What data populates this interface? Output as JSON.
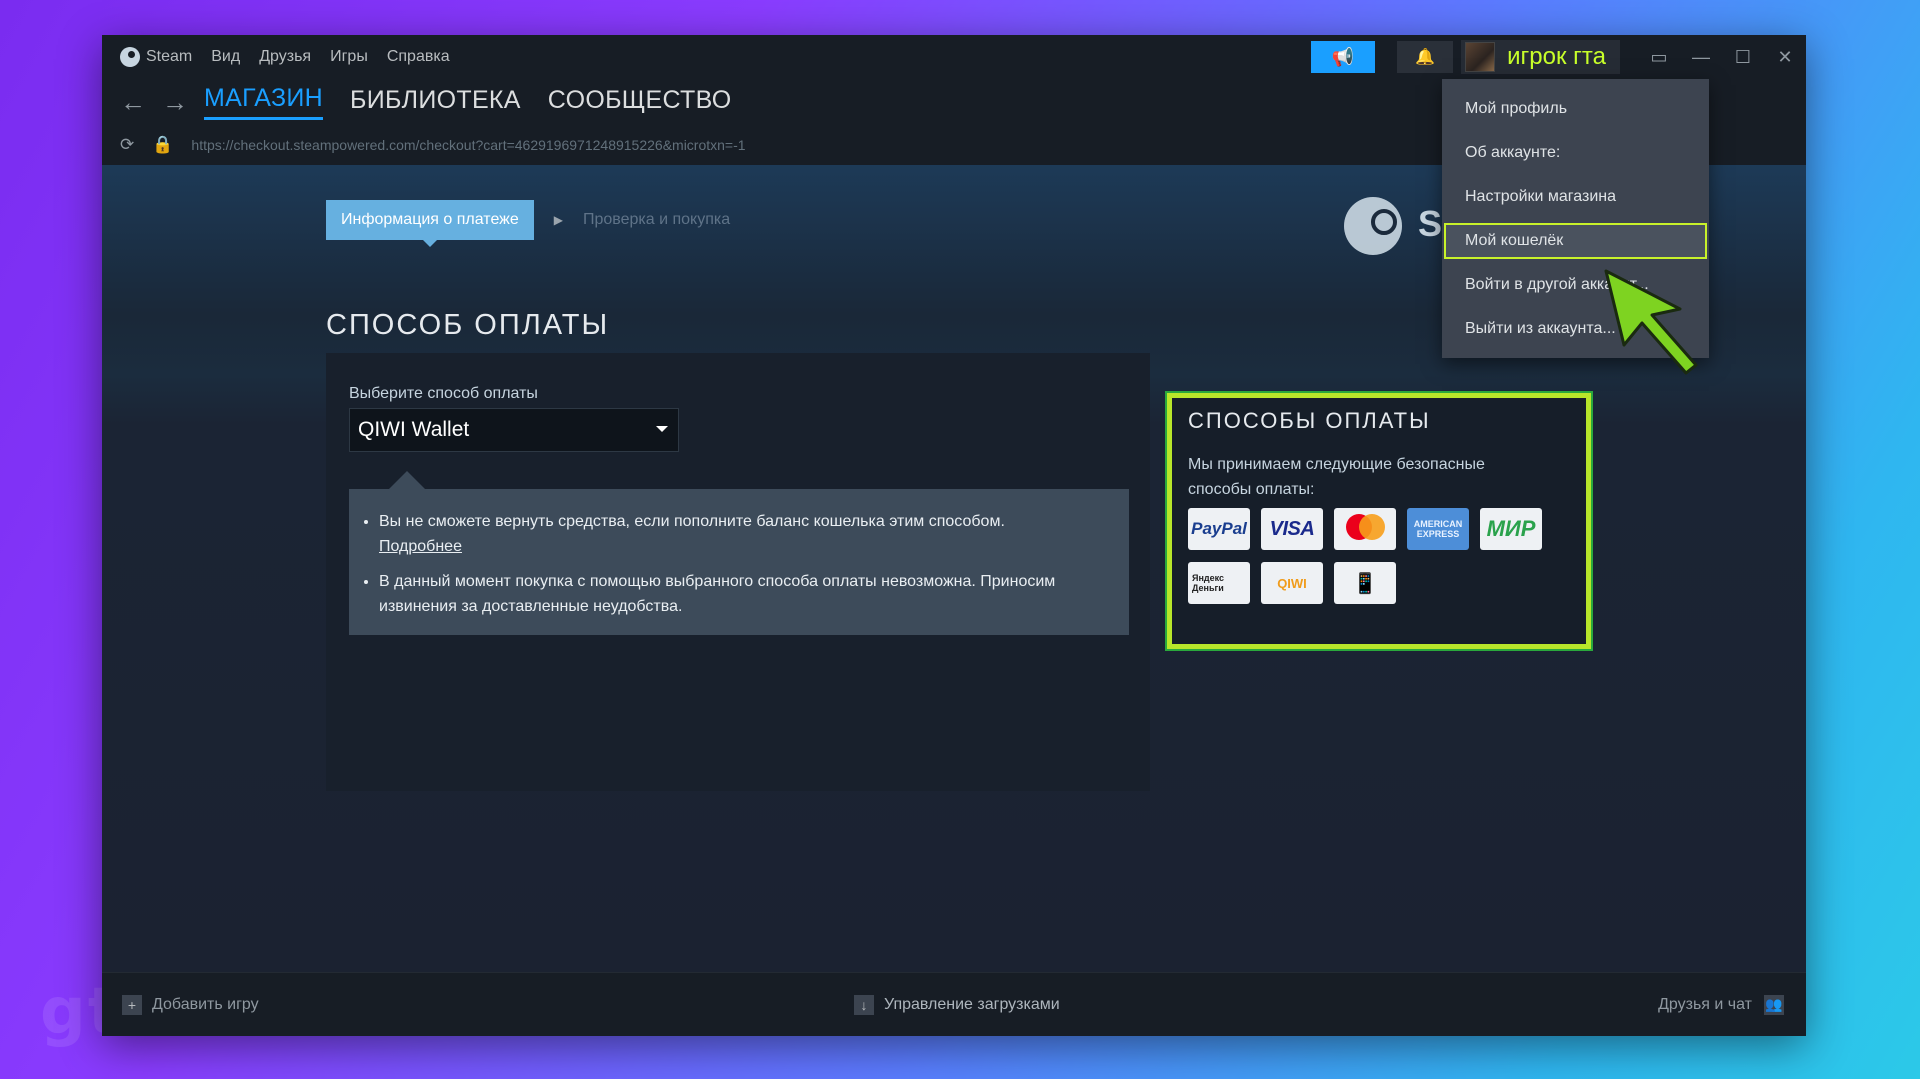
{
  "titlebar": {
    "app_name": "Steam",
    "menu": [
      "Вид",
      "Друзья",
      "Игры",
      "Справка"
    ],
    "username": "игрок гта"
  },
  "nav": {
    "tabs": [
      "МАГАЗИН",
      "БИБЛИОТЕКА",
      "СООБЩЕСТВО"
    ],
    "url": "https://checkout.steampowered.com/checkout?cart=4629196971248915226&microtxn=-1"
  },
  "checkout": {
    "step_active": "Информация о платеже",
    "step_next": "Проверка и покупка",
    "section_title": "СПОСОБ ОПЛАТЫ",
    "select_label": "Выберите способ оплаты",
    "selected_method": "QIWI Wallet",
    "notice_1": "Вы не сможете вернуть средства, если пополните баланс кошелька этим способом.",
    "notice_1_link": "Подробнее",
    "notice_2": "В данный момент покупка с помощью выбранного способа оплаты невозможна. Приносим извинения за доставленные неудобства."
  },
  "methods": {
    "title": "СПОСОБЫ ОПЛАТЫ",
    "description": "Мы принимаем следующие безопасные способы оплаты:",
    "logos": {
      "paypal": "PayPal",
      "visa": "VISA",
      "mastercard": "mastercard",
      "amex": "AMERICAN EXPRESS",
      "mir": "МИР",
      "yandex": "Яндекс Деньги",
      "qiwi": "QIWI"
    }
  },
  "bg_logo_text": "ST",
  "dropdown": {
    "items": [
      "Мой профиль",
      "Об аккаунте:",
      "Настройки магазина",
      "Мой кошелёк",
      "Войти в другой аккаунт...",
      "Выйти из аккаунта..."
    ]
  },
  "bottombar": {
    "add_game": "Добавить игру",
    "downloads": "Управление загрузками",
    "friends": "Друзья и чат"
  },
  "watermark": "gtashka",
  "colors": {
    "accent": "#1a9fff",
    "highlight": "#c8f22a",
    "username": "#c8ff2a"
  }
}
